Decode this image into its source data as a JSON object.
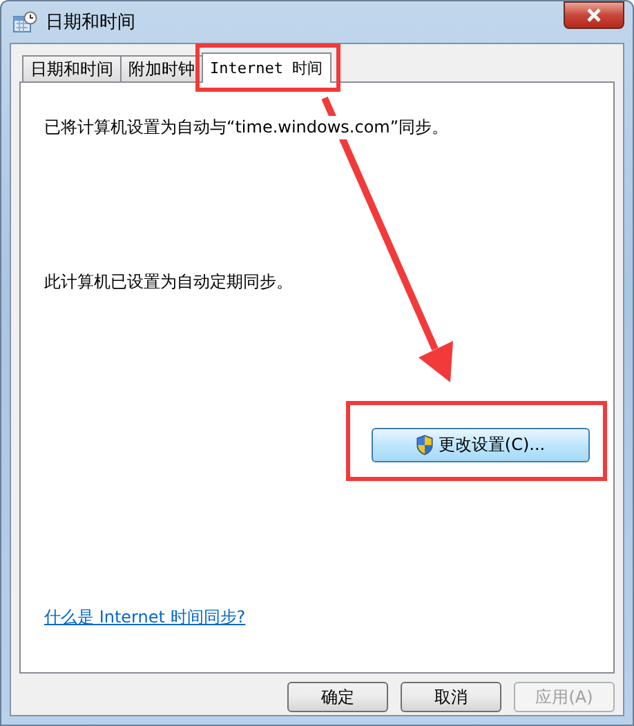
{
  "window": {
    "title": "日期和时间"
  },
  "tabs": [
    {
      "label": "日期和时间",
      "selected": false
    },
    {
      "label": "附加时钟",
      "selected": false
    },
    {
      "label": "Internet 时间",
      "selected": true
    }
  ],
  "panel": {
    "sync_text": "已将计算机设置为自动与“time.windows.com”同步。",
    "status_text": "此计算机已设置为自动定期同步。",
    "change_button": "更改设置(C)...",
    "help_link": "什么是 Internet 时间同步?"
  },
  "buttons": [
    {
      "label": "确定",
      "disabled": false
    },
    {
      "label": "取消",
      "disabled": false
    },
    {
      "label": "应用(A)",
      "disabled": true
    }
  ]
}
